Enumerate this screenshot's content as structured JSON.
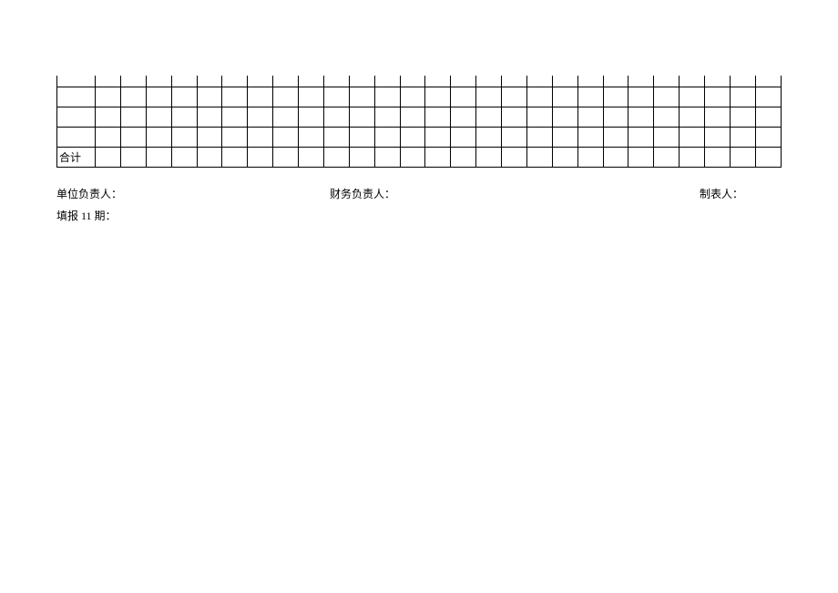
{
  "table": {
    "total_row_label": "合计",
    "columns": 28,
    "rows_above_total": 5
  },
  "footer": {
    "unit_responsible": "单位负责人：",
    "finance_responsible": "财务负责人：",
    "preparer": "制表人：",
    "report_period": "填报 11 期："
  }
}
